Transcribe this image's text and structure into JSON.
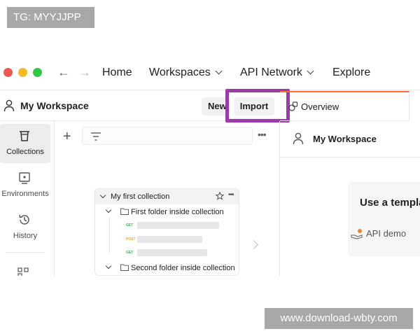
{
  "watermarks": {
    "top": "TG: MYYJJPP",
    "bottom": "www.download-wbty.com"
  },
  "nav": {
    "home": "Home",
    "workspaces": "Workspaces",
    "api_network": "API Network",
    "explore": "Explore",
    "back_glyph": "←",
    "forward_glyph": "→"
  },
  "workspace": {
    "title": "My Workspace",
    "new_label": "New",
    "import_label": "Import"
  },
  "tabs": [
    {
      "label": "Overview"
    }
  ],
  "right_panel": {
    "workspace_title": "My Workspace",
    "template_title": "Use a templa",
    "template_item": "API demo"
  },
  "sidebar": {
    "items": [
      {
        "label": "Collections",
        "icon": "trash-can-icon"
      },
      {
        "label": "Environments",
        "icon": "environment-icon"
      },
      {
        "label": "History",
        "icon": "history-icon"
      }
    ]
  },
  "collections_panel": {
    "plus_glyph": "+",
    "more_glyph": "•••",
    "collection_name": "My first collection",
    "head_more_glyph": "•••",
    "folders": [
      {
        "name": "First folder inside collection"
      },
      {
        "name": "Second folder inside collection"
      }
    ],
    "requests": [
      {
        "method": "GET"
      },
      {
        "method": "POST"
      },
      {
        "method": "GET"
      }
    ]
  },
  "colors": {
    "accent_tab": "#ff6c37",
    "highlight": "#9c3aa8",
    "get": "#49a85a",
    "post": "#d6a934"
  }
}
